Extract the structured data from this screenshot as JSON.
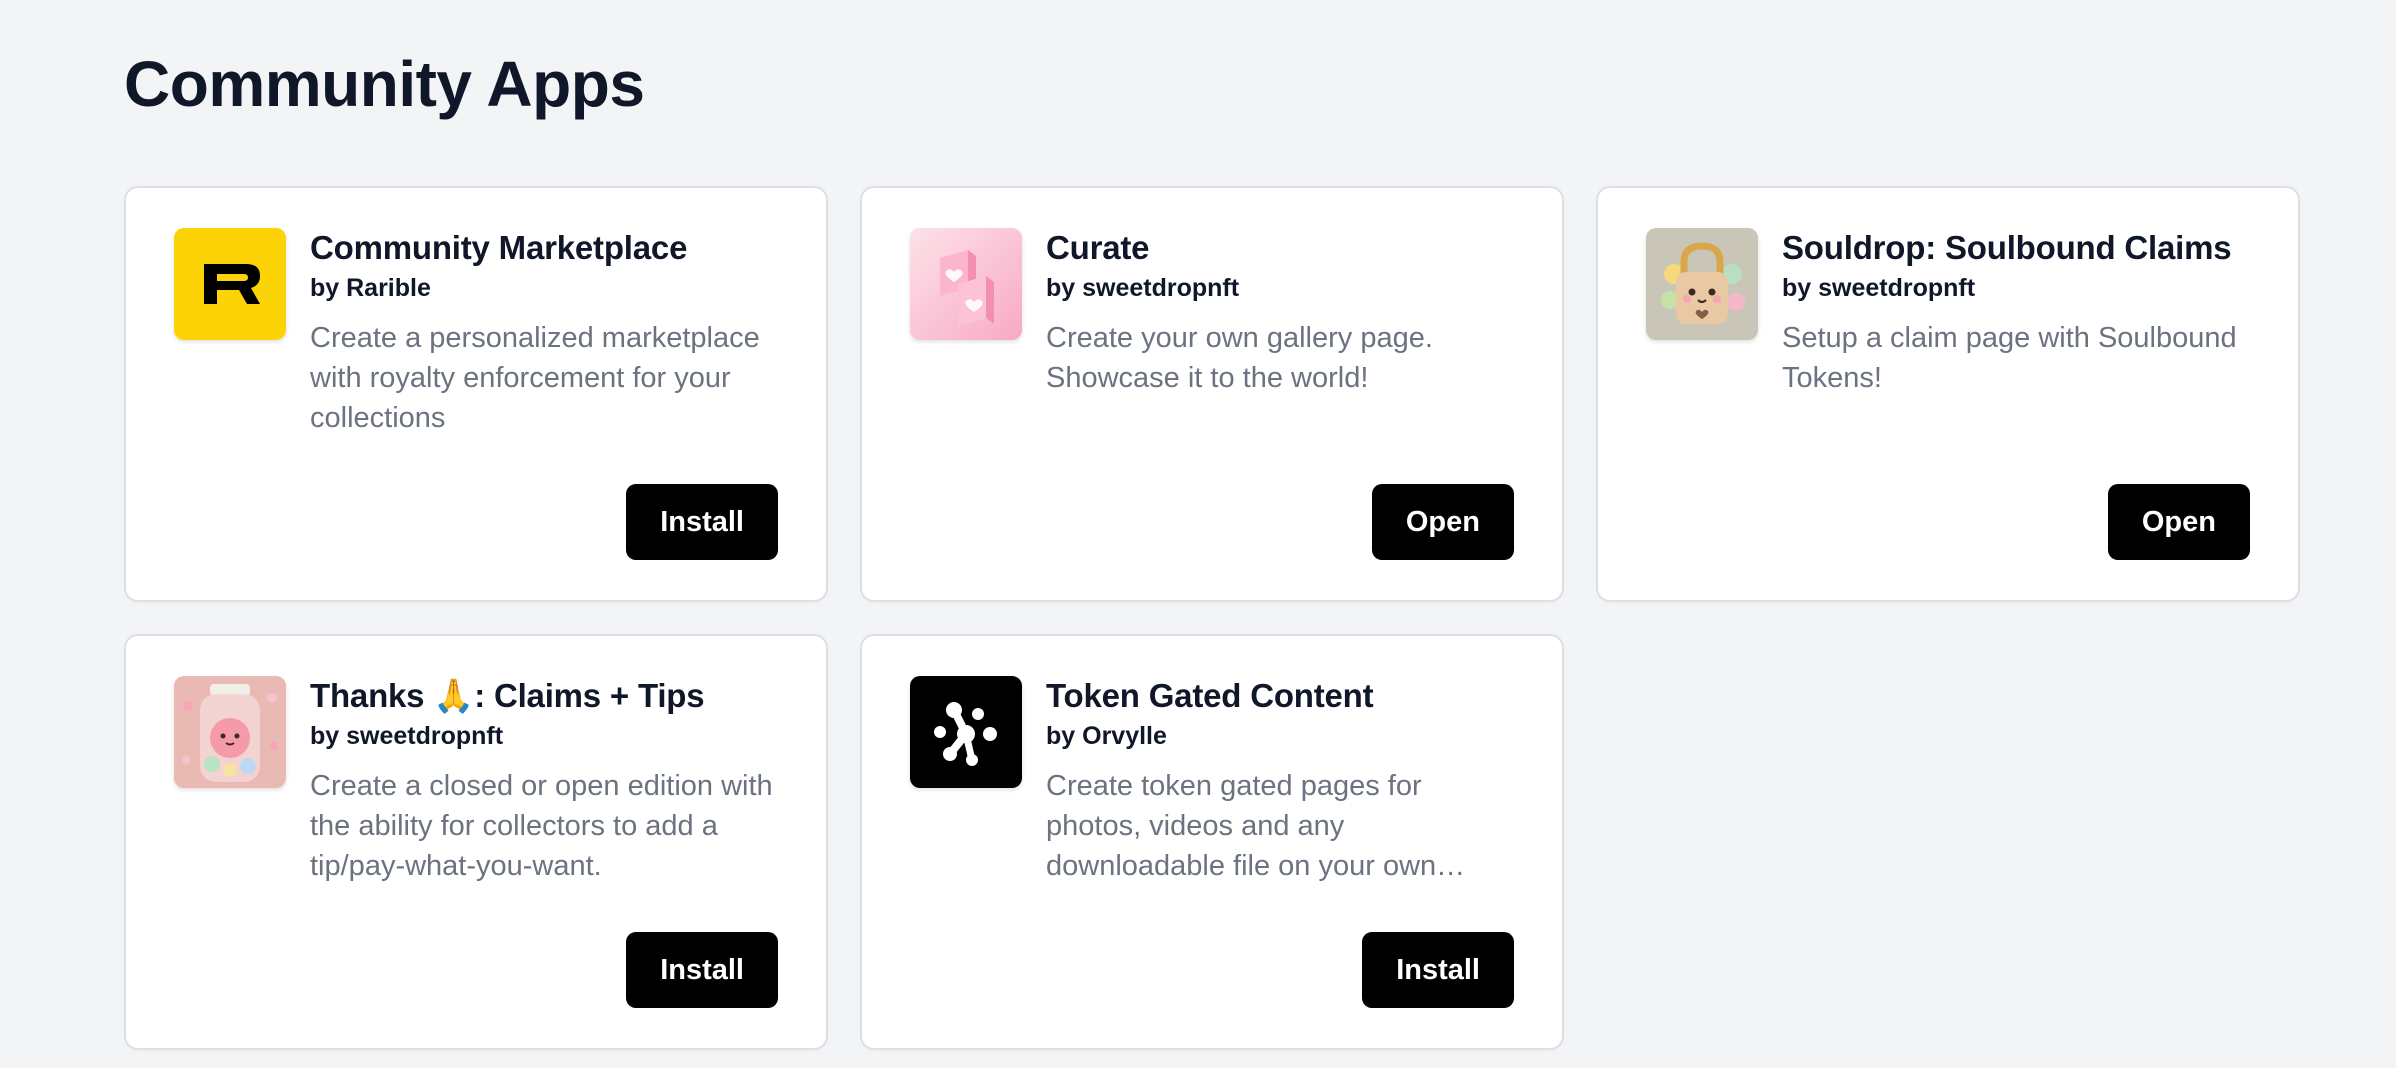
{
  "page": {
    "title": "Community Apps"
  },
  "colors": {
    "background": "#f3f4f6",
    "card": "#ffffff",
    "button": "#000000",
    "rarible_yellow": "#fcd307"
  },
  "apps": [
    {
      "title": "Community Marketplace",
      "author": "by Rarible",
      "description": "Create a personalized marketplace with royalty enforcement for your collections",
      "button_label": "Install",
      "icon": "rarible-logo-icon"
    },
    {
      "title": "Curate",
      "author": "by sweetdropnft",
      "description": "Create your own gallery page. Showcase it to the world!",
      "button_label": "Open",
      "icon": "pink-hearts-icon"
    },
    {
      "title": "Souldrop: Soulbound Claims",
      "author": "by sweetdropnft",
      "description": "Setup a claim page with Soulbound Tokens!",
      "button_label": "Open",
      "icon": "padlock-character-icon"
    },
    {
      "title": "Thanks 🙏: Claims + Tips",
      "author": "by sweetdropnft",
      "description": "Create a closed or open edition with the ability for collectors to add a tip/pay-what-you-want.",
      "button_label": "Install",
      "icon": "candy-jar-icon"
    },
    {
      "title": "Token Gated Content",
      "author": "by Orvylle",
      "description": "Create token gated pages for photos, videos and any downloadable file on your own website",
      "button_label": "Install",
      "icon": "orvylle-dots-icon"
    }
  ]
}
